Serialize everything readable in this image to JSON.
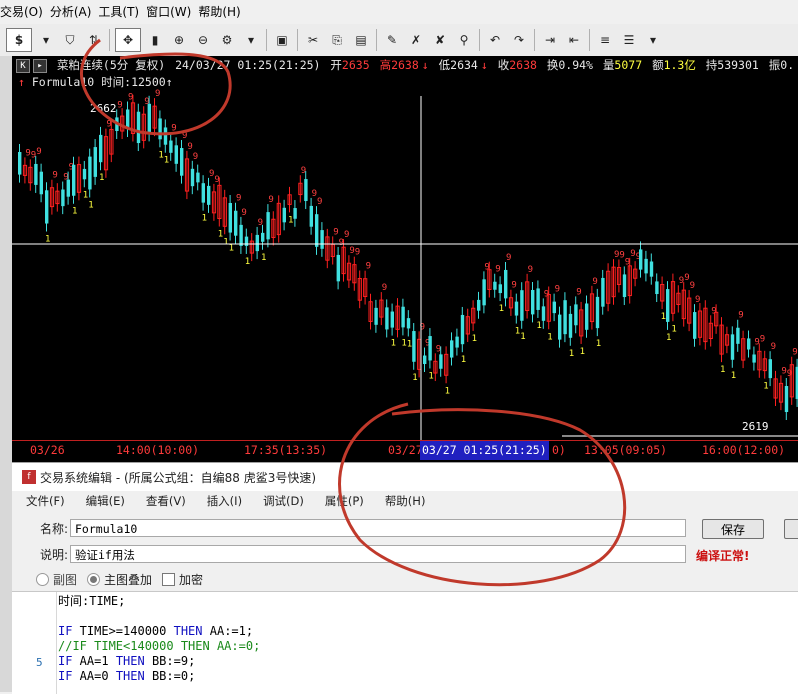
{
  "menubar": {
    "items": [
      "交易(O)",
      "分析(A)",
      "工具(T)",
      "窗口(W)",
      "帮助(H)"
    ]
  },
  "toolbar": {
    "symbol_button": "$",
    "icons": [
      "dollar-icon",
      "filter-icon",
      "refresh-icon",
      "move-icon",
      "cursor-icon",
      "zoom-in-icon",
      "zoom-out-icon",
      "gear-icon",
      "save-icon",
      "cut-icon",
      "copy-icon",
      "paste-icon",
      "draw-icon",
      "draw-cross-icon",
      "draw-x-icon",
      "binoculars-icon",
      "undo-icon",
      "redo-icon",
      "indent-icon",
      "outdent-icon",
      "list-icon",
      "list2-icon"
    ]
  },
  "chart": {
    "header": {
      "symbol": "菜粕连续(5分 复权)",
      "datetime": "24/03/27 01:25(21:25)",
      "open_label": "开",
      "open": "2635",
      "high_label": "高",
      "high": "2638",
      "low_label": "低",
      "low": "2634",
      "close_label": "收",
      "close": "2638",
      "turnover_label": "换",
      "turnover": "0.94%",
      "volume_label": "量",
      "volume": "5077",
      "amount_label": "额",
      "amount": "1.3亿",
      "oi_label": "持",
      "oi": "539301",
      "amp_label": "振",
      "amp": "0."
    },
    "formula_line": {
      "name": "Formula10",
      "time_label": "时间:",
      "time_value": "12500"
    },
    "high_marker": "2662",
    "low_marker": "2619",
    "signal_label_up": "9",
    "signal_label_down": "1",
    "colors": {
      "up": "#ff2020",
      "down": "#40e0e0",
      "signal9": "#ff4040",
      "signal1": "#ffff40",
      "background": "#000000",
      "crosshair": "#ffffff",
      "annotation": "#c0392b"
    },
    "time_axis": {
      "ticks": [
        "03/26",
        "14:00(10:00)",
        "17:35(13:35)",
        "03/27",
        "03/27 01:25(21:25)",
        "0)",
        "13:05(09:05)",
        "16:00(12:00)"
      ]
    }
  },
  "editor": {
    "title": "交易系统编辑 - (所属公式组：自编88 虎鲨3号快速)",
    "menu": [
      "文件(F)",
      "编辑(E)",
      "查看(V)",
      "插入(I)",
      "调试(D)",
      "属性(P)",
      "帮助(H)"
    ],
    "name_label": "名称:",
    "name_value": "Formula10",
    "desc_label": "说明:",
    "desc_value": "验证if用法",
    "save_button": "保存",
    "compile_status": "编译正常!",
    "options": {
      "sub_chart": "副图",
      "main_overlay": "主图叠加",
      "encrypt": "加密"
    },
    "code": {
      "line1": "时间:TIME;",
      "line2": "",
      "line3_kw": "IF",
      "line3": " TIME>=140000 ",
      "line3_then": "THEN",
      "line3_tail": " AA:=1;",
      "line4": "//IF TIME<140000 THEN AA:=0;",
      "line5_kw": "IF",
      "line5": " AA=1 ",
      "line5_then": "THEN",
      "line5_tail": " BB:=9;",
      "line6_kw": "IF",
      "line6": " AA=0 ",
      "line6_then": "THEN",
      "line6_tail": " BB:=0;",
      "line_number_5": "5"
    }
  }
}
